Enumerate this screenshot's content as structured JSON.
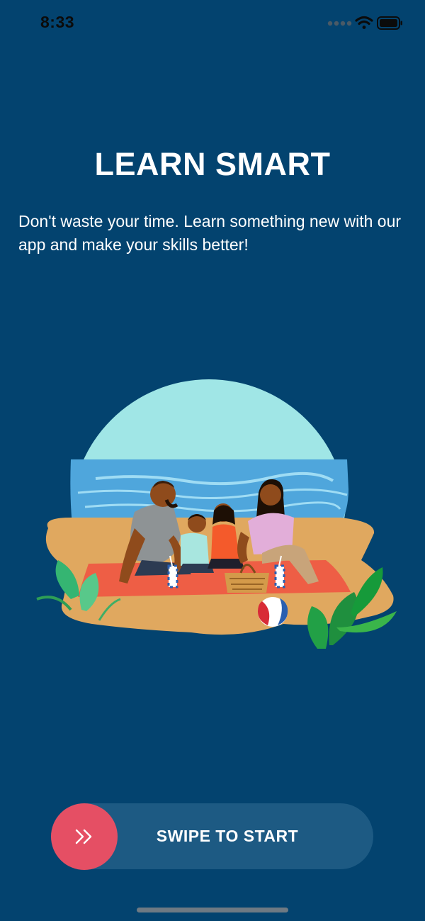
{
  "status_bar": {
    "time": "8:33",
    "icons": [
      "signal-dots-icon",
      "wifi-icon",
      "battery-icon"
    ]
  },
  "hero": {
    "title": "LEARN SMART",
    "subtitle": "Don't waste your time. Learn something new with our app and make your skills better!"
  },
  "illustration": {
    "name": "family-picnic-beach-illustration"
  },
  "swipe": {
    "label": "SWIPE TO START",
    "knob_icon": "double-chevron-right-icon"
  },
  "colors": {
    "background": "#03436f",
    "track": "#1d5a83",
    "knob": "#e54f64",
    "text": "#ffffff"
  }
}
